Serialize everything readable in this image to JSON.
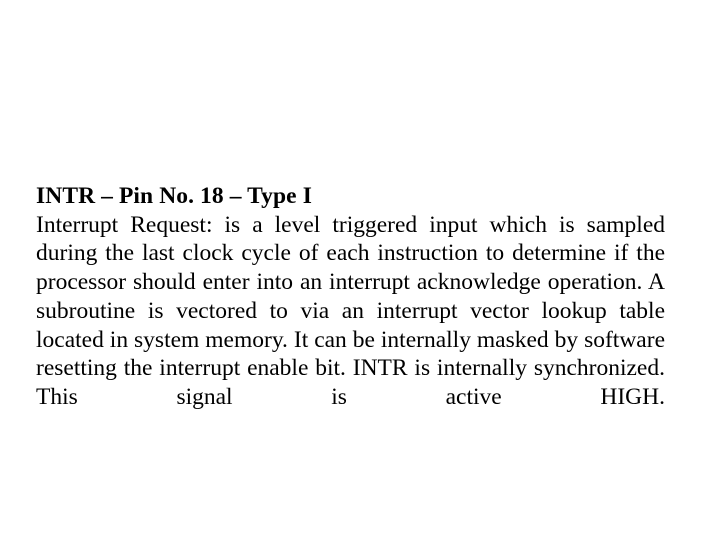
{
  "slide": {
    "background_color": "#ffffff",
    "text_color": "#000000",
    "heading": "INTR – Pin No. 18 – Type I",
    "body": "Interrupt Request: is a level triggered input which is sampled during the last clock cycle of each instruction to determine if the processor should enter into an interrupt acknowledge operation. A subroutine is vectored to via an interrupt vector lookup table located in system memory. It can be internally masked by software resetting the interrupt enable bit. INTR is internally synchronized. This signal is active HIGH.",
    "lines": [
      "INTR – Pin No. 18 – Type I",
      "Interrupt Request: is a level triggered input which is sampled",
      "during the last clock cycle of each instruction to determine if the",
      "processor should enter into an interrupt acknowledge operation. A",
      "subroutine is vectored to via an interrupt vector lookup table",
      "located in system memory. It can be internally masked by",
      "software resetting the interrupt enable bit. INTR is internally",
      "synchronized. This signal is active HIGH."
    ]
  }
}
